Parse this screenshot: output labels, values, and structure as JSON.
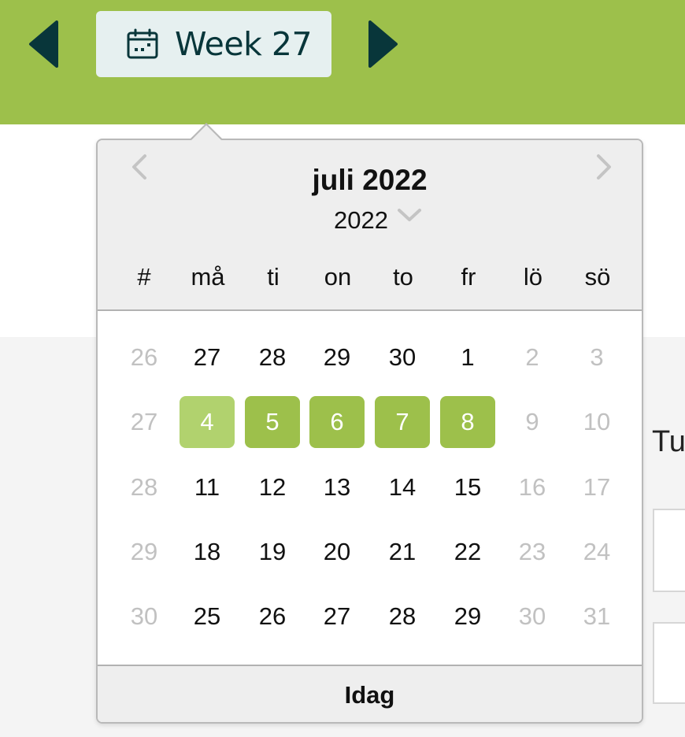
{
  "header": {
    "week_label": "Week 27",
    "prev_icon": "triangle-left-icon",
    "next_icon": "triangle-right-icon",
    "calendar_icon": "calendar-icon",
    "accent_color": "#9dc04b",
    "dark_color": "#08363a"
  },
  "background": {
    "side_label": "Tu"
  },
  "datepicker": {
    "month_title": "juli 2022",
    "year_value": "2022",
    "weekday_headers": [
      "#",
      "må",
      "ti",
      "on",
      "to",
      "fr",
      "lö",
      "sö"
    ],
    "weeks": [
      {
        "week": "26",
        "days": [
          "27",
          "28",
          "29",
          "30",
          "1",
          "2",
          "3"
        ],
        "muted": [
          false,
          false,
          false,
          false,
          false,
          true,
          true
        ]
      },
      {
        "week": "27",
        "days": [
          "4",
          "5",
          "6",
          "7",
          "8",
          "9",
          "10"
        ],
        "muted": [
          false,
          false,
          false,
          false,
          false,
          true,
          true
        ]
      },
      {
        "week": "28",
        "days": [
          "11",
          "12",
          "13",
          "14",
          "15",
          "16",
          "17"
        ],
        "muted": [
          false,
          false,
          false,
          false,
          false,
          true,
          true
        ]
      },
      {
        "week": "29",
        "days": [
          "18",
          "19",
          "20",
          "21",
          "22",
          "23",
          "24"
        ],
        "muted": [
          false,
          false,
          false,
          false,
          false,
          true,
          true
        ]
      },
      {
        "week": "30",
        "days": [
          "25",
          "26",
          "27",
          "28",
          "29",
          "30",
          "31"
        ],
        "muted": [
          false,
          false,
          false,
          false,
          false,
          true,
          true
        ]
      }
    ],
    "selected_week_index": 1,
    "selected_days": [
      "4",
      "5",
      "6",
      "7",
      "8"
    ],
    "today_day": "4",
    "footer_label": "Idag",
    "selected_color": "#9dc04b",
    "today_color": "#b1d26e"
  }
}
